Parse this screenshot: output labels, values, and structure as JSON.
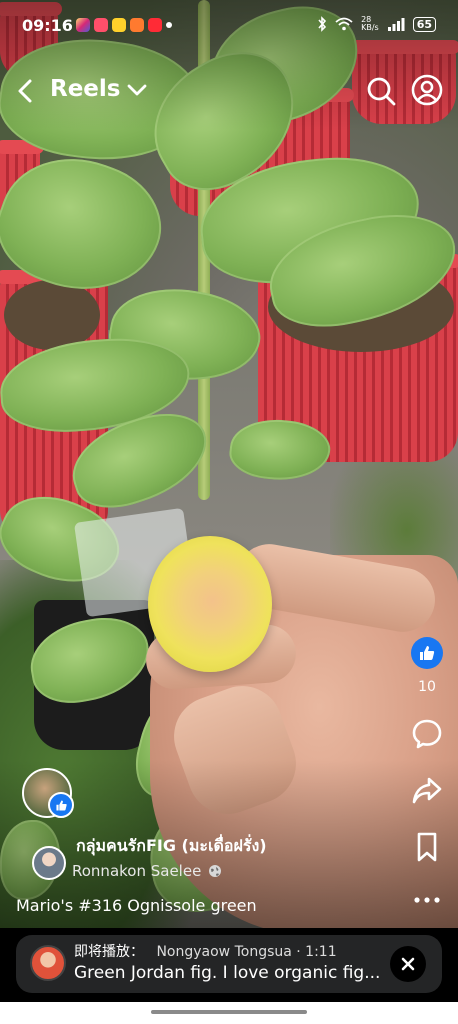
{
  "status_bar": {
    "time": "09:16",
    "network": "28\nKB/s",
    "battery": "65"
  },
  "header": {
    "title": "Reels"
  },
  "actions": {
    "like_count": "10"
  },
  "post": {
    "group_name": "กลุ่มคนรักFIG (มะเดื่อฝรั่ง)",
    "author": "Ronnakon Saelee",
    "caption": "Mario's #316 Ognissole green"
  },
  "up_next": {
    "label": "即将播放：",
    "author": "Nongyaow Tongsua",
    "duration": "· 1:11",
    "title": "Green Jordan fig. I love organic fig..."
  },
  "colors": {
    "like_blue": "#1877f2",
    "up_next_bg": "#242526"
  }
}
